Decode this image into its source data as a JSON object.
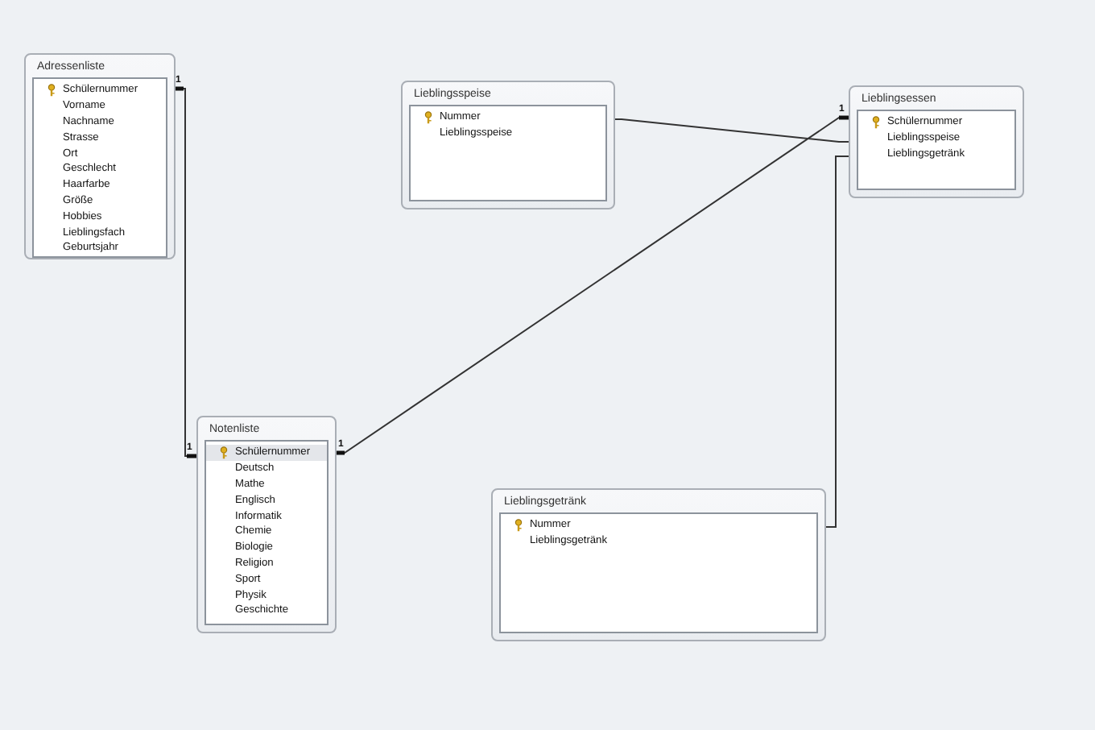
{
  "tables": [
    {
      "title": "Adressenliste",
      "fields": [
        {
          "name": "Schülernummer",
          "key": true,
          "selected": false
        },
        {
          "name": "Vorname",
          "key": false,
          "selected": false
        },
        {
          "name": "Nachname",
          "key": false,
          "selected": false
        },
        {
          "name": "Strasse",
          "key": false,
          "selected": false
        },
        {
          "name": "Ort",
          "key": false,
          "selected": false
        },
        {
          "name": "Geschlecht",
          "key": false,
          "selected": false
        },
        {
          "name": "Haarfarbe",
          "key": false,
          "selected": false
        },
        {
          "name": "Größe",
          "key": false,
          "selected": false
        },
        {
          "name": "Hobbies",
          "key": false,
          "selected": false
        },
        {
          "name": "Lieblingsfach",
          "key": false,
          "selected": false
        },
        {
          "name": "Geburtsjahr",
          "key": false,
          "selected": false
        }
      ]
    },
    {
      "title": "Lieblingsspeise",
      "fields": [
        {
          "name": "Nummer",
          "key": true,
          "selected": false
        },
        {
          "name": "Lieblingsspeise",
          "key": false,
          "selected": false
        }
      ]
    },
    {
      "title": "Lieblingsessen",
      "fields": [
        {
          "name": "Schülernummer",
          "key": true,
          "selected": false
        },
        {
          "name": "Lieblingsspeise",
          "key": false,
          "selected": false
        },
        {
          "name": "Lieblingsgetränk",
          "key": false,
          "selected": false
        }
      ]
    },
    {
      "title": "Notenliste",
      "fields": [
        {
          "name": "Schülernummer",
          "key": true,
          "selected": true
        },
        {
          "name": "Deutsch",
          "key": false,
          "selected": false
        },
        {
          "name": "Mathe",
          "key": false,
          "selected": false
        },
        {
          "name": "Englisch",
          "key": false,
          "selected": false
        },
        {
          "name": "Informatik",
          "key": false,
          "selected": false
        },
        {
          "name": "Chemie",
          "key": false,
          "selected": false
        },
        {
          "name": "Biologie",
          "key": false,
          "selected": false
        },
        {
          "name": "Religion",
          "key": false,
          "selected": false
        },
        {
          "name": "Sport",
          "key": false,
          "selected": false
        },
        {
          "name": "Physik",
          "key": false,
          "selected": false
        },
        {
          "name": "Geschichte",
          "key": false,
          "selected": false
        }
      ]
    },
    {
      "title": "Lieblingsgetränk",
      "fields": [
        {
          "name": "Nummer",
          "key": true,
          "selected": false
        },
        {
          "name": "Lieblingsgetränk",
          "key": false,
          "selected": false
        }
      ]
    }
  ],
  "relationships": [
    {
      "enforced": true,
      "from_label": "1",
      "to_label": "1"
    },
    {
      "enforced": true,
      "from_label": "1",
      "to_label": "1"
    },
    {
      "enforced": false
    },
    {
      "enforced": false
    }
  ]
}
